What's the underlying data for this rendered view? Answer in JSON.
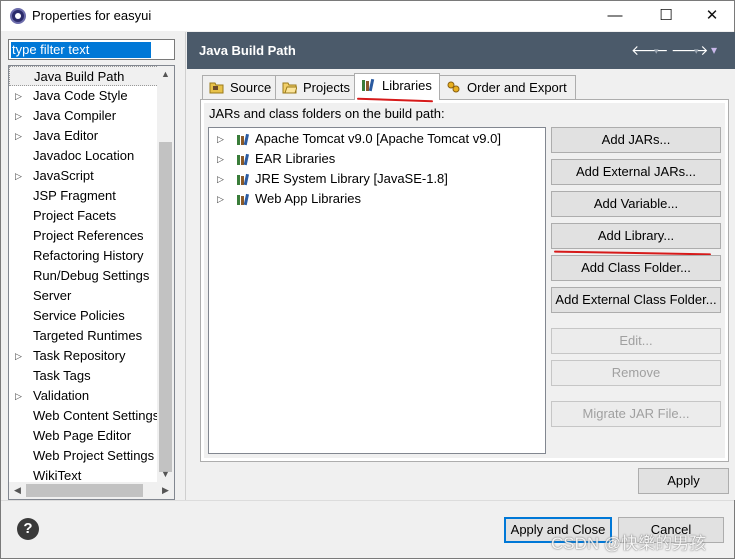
{
  "window": {
    "title": "Properties for easyui",
    "minimize_glyph": "—",
    "maximize_glyph": "☐",
    "close_glyph": "✕",
    "icon": "eclipse-icon"
  },
  "filter": {
    "value": "type filter text"
  },
  "sidebar": {
    "items": [
      {
        "label": "Java Build Path",
        "expandable": false,
        "selected": true
      },
      {
        "label": "Java Code Style",
        "expandable": true
      },
      {
        "label": "Java Compiler",
        "expandable": true
      },
      {
        "label": "Java Editor",
        "expandable": true
      },
      {
        "label": "Javadoc Location",
        "expandable": false
      },
      {
        "label": "JavaScript",
        "expandable": true
      },
      {
        "label": "JSP Fragment",
        "expandable": false
      },
      {
        "label": "Project Facets",
        "expandable": false
      },
      {
        "label": "Project References",
        "expandable": false
      },
      {
        "label": "Refactoring History",
        "expandable": false
      },
      {
        "label": "Run/Debug Settings",
        "expandable": false
      },
      {
        "label": "Server",
        "expandable": false
      },
      {
        "label": "Service Policies",
        "expandable": false
      },
      {
        "label": "Targeted Runtimes",
        "expandable": false
      },
      {
        "label": "Task Repository",
        "expandable": true
      },
      {
        "label": "Task Tags",
        "expandable": false
      },
      {
        "label": "Validation",
        "expandable": true
      },
      {
        "label": "Web Content Settings",
        "expandable": false
      },
      {
        "label": "Web Page Editor",
        "expandable": false
      },
      {
        "label": "Web Project Settings",
        "expandable": false
      },
      {
        "label": "WikiText",
        "expandable": false
      }
    ]
  },
  "header": {
    "title": "Java Build Path",
    "back_glyph": "🡐",
    "forward_glyph": "🡒",
    "dropdown_glyph": "▾",
    "menu_glyph": "▾"
  },
  "tabs": [
    {
      "label": "Source",
      "icon": "source-folder-icon"
    },
    {
      "label": "Projects",
      "icon": "projects-icon"
    },
    {
      "label": "Libraries",
      "icon": "libraries-icon",
      "active": true
    },
    {
      "label": "Order and Export",
      "icon": "order-export-icon"
    }
  ],
  "libraries": {
    "caption": "JARs and class folders on the build path:",
    "items": [
      {
        "label": "Apache Tomcat v9.0 [Apache Tomcat v9.0]"
      },
      {
        "label": "EAR Libraries"
      },
      {
        "label": "JRE System Library [JavaSE-1.8]"
      },
      {
        "label": "Web App Libraries"
      }
    ]
  },
  "buttons": {
    "add_jars": "Add JARs...",
    "add_external_jars": "Add External JARs...",
    "add_variable": "Add Variable...",
    "add_library": "Add Library...",
    "add_class_folder": "Add Class Folder...",
    "add_external_class_folder": "Add External Class Folder...",
    "edit": "Edit...",
    "remove": "Remove",
    "migrate_jar": "Migrate JAR File...",
    "apply": "Apply",
    "apply_and_close": "Apply and Close",
    "cancel": "Cancel"
  },
  "help_glyph": "?",
  "watermark": "CSDN @快樂的男孩",
  "colors": {
    "header_bg": "#4b5a6a",
    "selection_blue": "#0078d7",
    "annotation_red": "#d61a1a"
  }
}
